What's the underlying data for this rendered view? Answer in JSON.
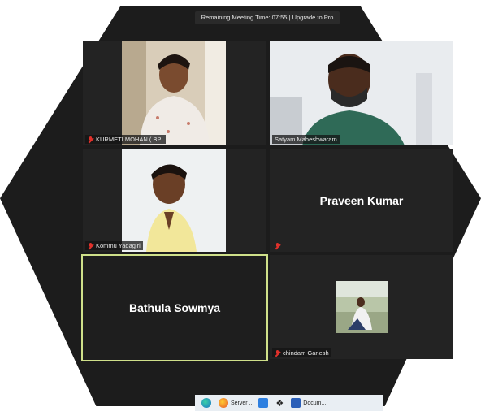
{
  "meeting": {
    "timer_text": "Remaining Meeting Time: 07:55 | Upgrade to Pro"
  },
  "participants": [
    {
      "name": "KURMETI MOHAN ( BPI",
      "video": true,
      "muted": true
    },
    {
      "name": "Satyam Maheshwaram",
      "video": true,
      "muted": false
    },
    {
      "name": "Kommu Yadagiri",
      "video": true,
      "muted": true
    },
    {
      "name": "Praveen Kumar",
      "video": false,
      "muted": true
    },
    {
      "name": "Bathula Sowmya",
      "video": false,
      "muted": true,
      "active_speaker": true
    },
    {
      "name": "chindam Ganesh",
      "video": true,
      "muted": true
    }
  ],
  "taskbar": {
    "items": [
      {
        "icon": "edge-icon",
        "label": ""
      },
      {
        "icon": "firefox-icon",
        "label": "Server ..."
      },
      {
        "icon": "settings-app-icon",
        "label": ""
      },
      {
        "icon": "dropbox-icon",
        "label": ""
      },
      {
        "icon": "word-icon",
        "label": "Docum..."
      }
    ]
  },
  "colors": {
    "background": "#1c1c1c",
    "tile": "#232323",
    "active_border": "#cfe08a",
    "mute_red": "#e0312b"
  }
}
